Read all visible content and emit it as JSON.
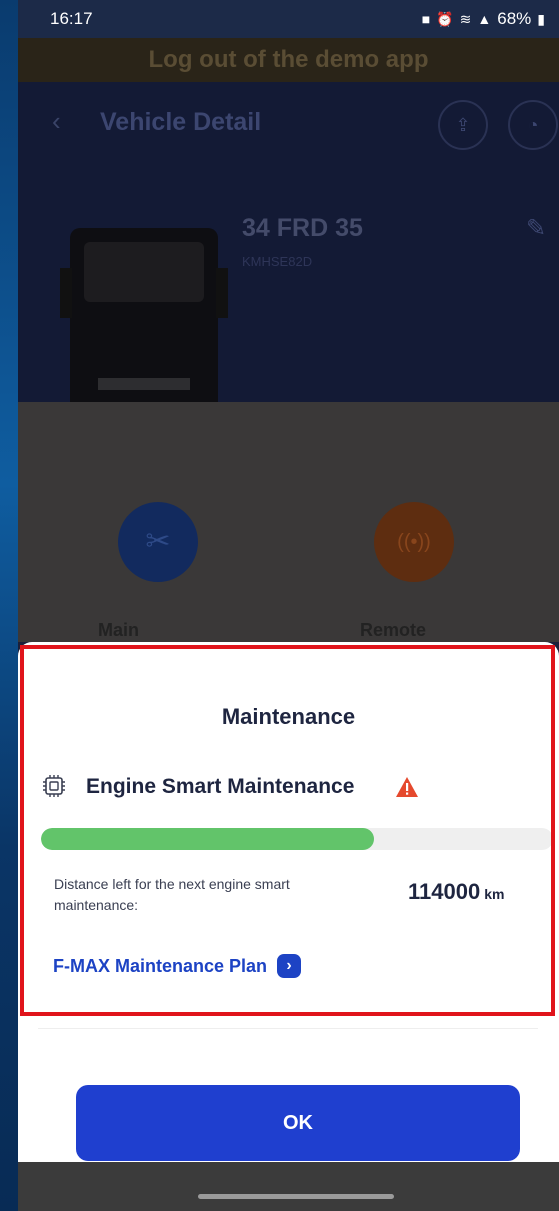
{
  "status_bar": {
    "time": "16:17",
    "icons": [
      "notification-icon",
      "alarm-icon",
      "lte-icon",
      "signal-icon"
    ],
    "battery": "68%"
  },
  "demo_banner": {
    "text": "Log out of the demo app"
  },
  "header": {
    "title": "Vehicle Detail",
    "plate": "34 FRD 35",
    "vin": "KMHSE82D"
  },
  "tiles": {
    "left_label": "Main",
    "right_label": "Remote"
  },
  "maintenance_sheet": {
    "title": "Maintenance",
    "item_label": "Engine Smart Maintenance",
    "progress_fraction": 0.65,
    "progress_color": "#62c46a",
    "distance_label": "Distance left for the next engine smart maintenance:",
    "distance_value": "114000",
    "distance_unit": "km",
    "plan_link": "F-MAX Maintenance Plan",
    "ok_label": "OK"
  },
  "colors": {
    "accent": "#1f3fcf",
    "warning": "#e5492d",
    "highlight": "#e0141b"
  }
}
